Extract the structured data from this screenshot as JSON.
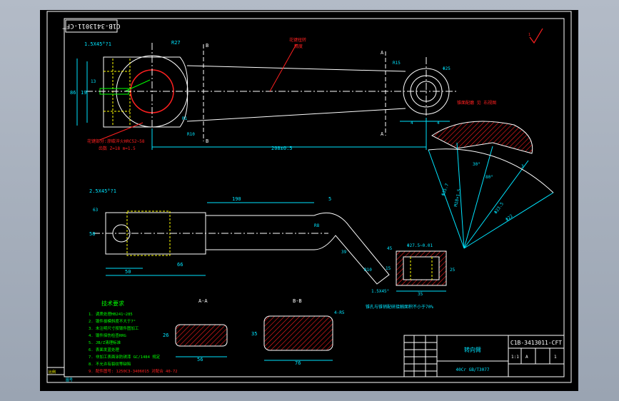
{
  "drawing": {
    "code_rotated": "C1B-3413011-CFT",
    "code_title": "C1B-3413011-CFT",
    "title_block_name": "转向臂",
    "material": "  40Cr GB/T3077",
    "title_block_small_1": "1:1",
    "title_block_small_2": "A",
    "title_block_small_3": "1",
    "fragment_left_bottom": "比例",
    "fragment_corner": "图号"
  },
  "top_view": {
    "dim_spline": "1.5X45°?1",
    "dim_pitch": "86",
    "dim_phi": "19",
    "dim_small1": "13",
    "dim_small2": "R",
    "dim_r1": "R27",
    "dim_r2": "R25",
    "dim_section": "B",
    "dim_section2": "A",
    "dim_a1": "A",
    "dim_a2": "A",
    "dim_b1": "B",
    "dim_b2": "B",
    "dim_center": "208±0.5",
    "dim_r3": "R15",
    "dim_phi2": "Φ25",
    "dim_r4": "4",
    "dim_r5": "4",
    "dim_r6": "R1",
    "dim_r7": "R10",
    "note_red_1": "花键扭转",
    "note_red_2": "精度",
    "note_red_3": "花键部分:渗碳淬火HRC52~58",
    "note_yellow": "齿数 Z=18  m=1.5",
    "note_right": "锥面配磨 见 右视图"
  },
  "front_view": {
    "dim_chamfer": "2.5X45°?1",
    "dim_190": "190",
    "dim_5": "5",
    "dim_50": "50",
    "dim_60": "66",
    "dim_58": "58",
    "dim_63": "63",
    "dim_r": "R8",
    "dim_39": "39",
    "dim_r10": "R10",
    "dim_35": "35",
    "dim_25": "25",
    "dim_15": "15",
    "dim_45": "45",
    "dim_m": "1.5X45°",
    "dim_cone": "Φ27.5~0.01",
    "note_bottom": "锥孔与锥销配研接触面积不小于70%"
  },
  "detail_view": {
    "dim_a": "Φ35.7",
    "dim_b": "M18×1.5",
    "dim_c": "Φ23.5",
    "dim_d": "Φ22",
    "dim_e": "30°",
    "dim_f": "3",
    "dim_g": "80°"
  },
  "section_a": {
    "label": "A-A",
    "dim_width": "56",
    "dim_height": "26"
  },
  "section_b": {
    "label": "B-B",
    "dim_width": "76",
    "dim_height": "35",
    "dim_r": "4-R5"
  },
  "tech_req": {
    "title": "技术要求",
    "items": [
      "1.  调质处理HB241~285",
      "2.  锻件拔模斜度不大于7°",
      "3.  未注明尺寸按锻件图加工",
      "4.  锻件探伤检查RRG",
      "5.  JB/Z清理标准",
      "6.  表面发蓝处理",
      "7.  非加工表面涂防锈漆 GC/1484 规定",
      "8.  不允许有裂纹等缺陷",
      "9.  配件图号: 1250C3-3406015 对配合 40-72"
    ]
  },
  "colors": {
    "outline": "#ffffff",
    "dimension": "#00e5ff",
    "hidden": "#ffff00",
    "hatch": "#ff2020",
    "green": "#00ff00"
  }
}
